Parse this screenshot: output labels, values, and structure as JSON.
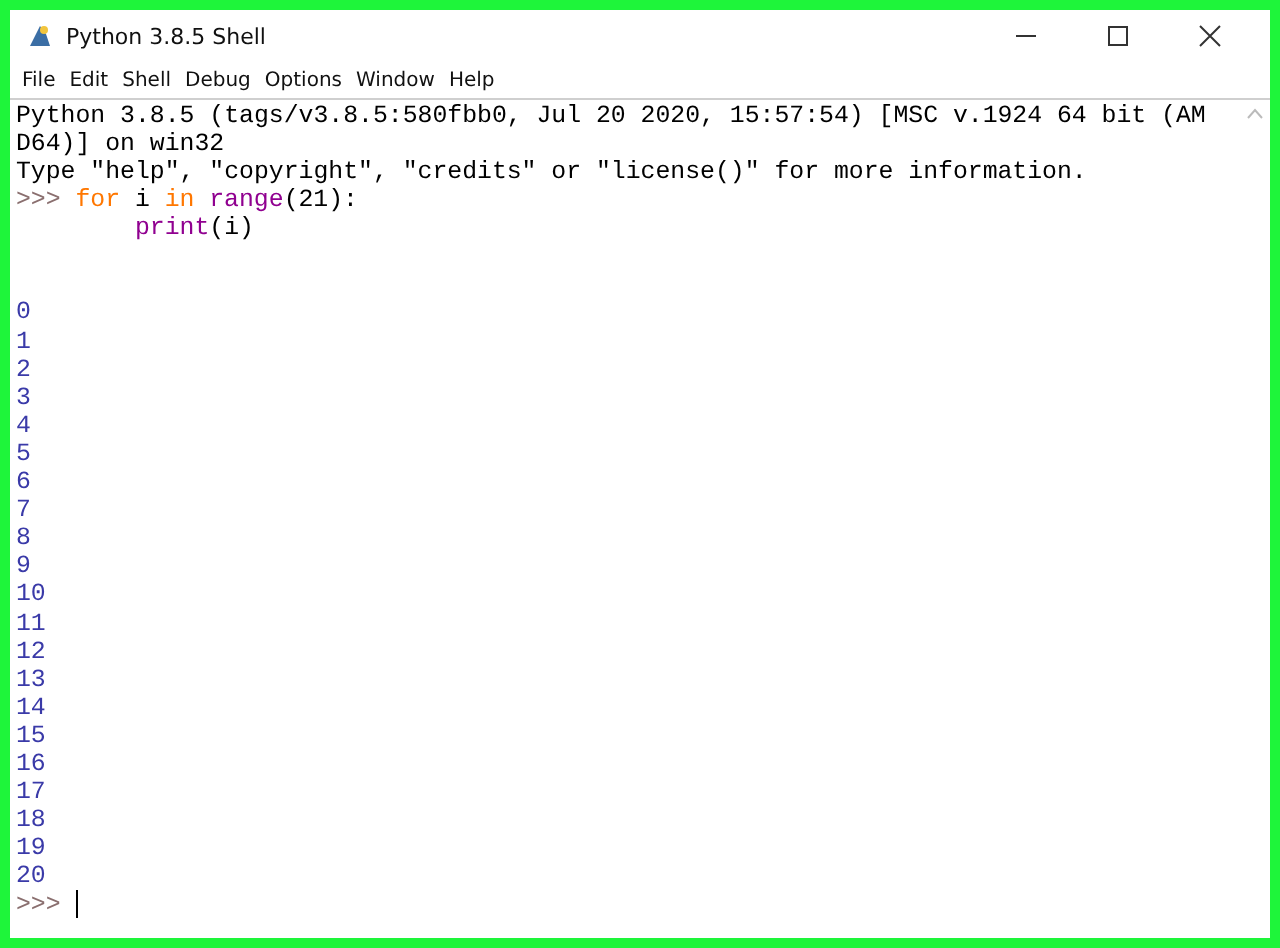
{
  "window": {
    "title": "Python 3.8.5 Shell"
  },
  "menu": [
    "File",
    "Edit",
    "Shell",
    "Debug",
    "Options",
    "Window",
    "Help"
  ],
  "banner": [
    "Python 3.8.5 (tags/v3.8.5:580fbb0, Jul 20 2020, 15:57:54) [MSC v.1924 64 bit (AM",
    "D64)] on win32",
    "Type \"help\", \"copyright\", \"credits\" or \"license()\" for more information."
  ],
  "input": [
    {
      "kind": "prompt",
      "tokens": [
        {
          "text": ">>>",
          "kind": "prompt"
        },
        {
          "text": "for",
          "kind": "keyword"
        },
        {
          "text": "i",
          "kind": "plain"
        },
        {
          "text": "in",
          "kind": "keyword"
        },
        {
          "text": "range",
          "kind": "builtin"
        },
        {
          "text": "(21):",
          "kind": "plain"
        }
      ]
    },
    {
      "kind": "continuation",
      "tokens": [
        {
          "text": "print",
          "kind": "builtin"
        },
        {
          "text": "(i)",
          "kind": "plain"
        }
      ]
    }
  ],
  "output": [
    "0",
    "1",
    "2",
    "3",
    "4",
    "5",
    "6",
    "7",
    "8",
    "9",
    "10",
    "11",
    "12",
    "13",
    "14",
    "15",
    "16",
    "17",
    "18",
    "19",
    "20"
  ],
  "final_prompt": ">>>"
}
